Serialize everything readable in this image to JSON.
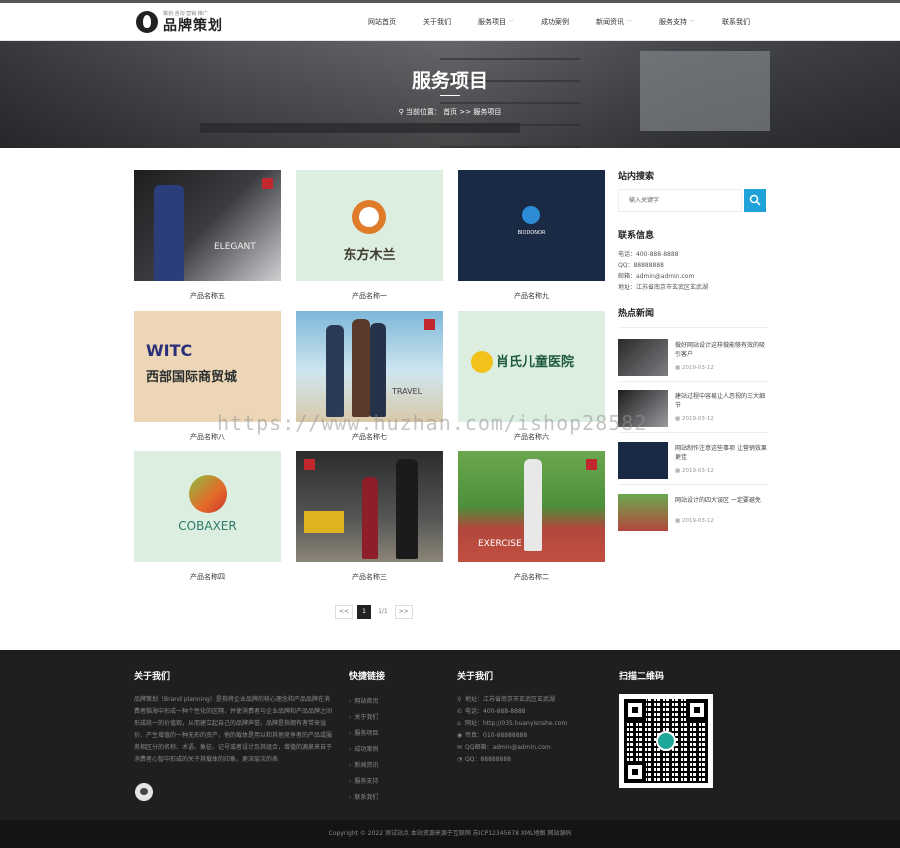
{
  "header": {
    "logo_slogan": "策划·咨询·营销·推广",
    "logo_name": "品牌策划",
    "nav": [
      {
        "label": "网站首页",
        "dropdown": false
      },
      {
        "label": "关于我们",
        "dropdown": false
      },
      {
        "label": "服务项目",
        "dropdown": true
      },
      {
        "label": "成功案例",
        "dropdown": false
      },
      {
        "label": "新闻资讯",
        "dropdown": true
      },
      {
        "label": "服务支持",
        "dropdown": true
      },
      {
        "label": "联系我们",
        "dropdown": false
      }
    ]
  },
  "banner": {
    "title": "服务项目",
    "crumb_prefix": "当前位置：",
    "crumb_home": "首页",
    "crumb_sep": ">>",
    "crumb_current": "服务项目"
  },
  "products": [
    {
      "name": "产品名称五",
      "thumb_text": "ELEGANT"
    },
    {
      "name": "产品名称一",
      "thumb_text": "东方木兰"
    },
    {
      "name": "产品名称九",
      "thumb_text": "BIODONOR"
    },
    {
      "name": "产品名称八",
      "thumb_text": "西部国际商贸城"
    },
    {
      "name": "产品名称七",
      "thumb_text": "TRAVEL"
    },
    {
      "name": "产品名称六",
      "thumb_text": "肖氏儿童医院"
    },
    {
      "name": "产品名称四",
      "thumb_text": "COBAXER"
    },
    {
      "name": "产品名称三",
      "thumb_text": ""
    },
    {
      "name": "产品名称二",
      "thumb_text": "EXERCISE"
    }
  ],
  "sidebar": {
    "search_title": "站内搜索",
    "search_placeholder": "输入关键字",
    "contact_title": "联系信息",
    "contact_lines": [
      "电话：400-888-8888",
      "QQ：88888888",
      "邮箱：admin@admin.com",
      "地址：江苏省南京市玄武区玄武湖"
    ],
    "news_title": "热点新闻",
    "news": [
      {
        "title": "做好网站设计这样做能够有效的吸引客户",
        "date": "2019-03-12"
      },
      {
        "title": "建站过程中容易让人忽视的三大细节",
        "date": "2019-03-12"
      },
      {
        "title": "网站制作注意这些事项 让营销效果更佳",
        "date": "2019-03-12"
      },
      {
        "title": "网站设计的四大误区 一定要避免",
        "date": "2019-03-12"
      }
    ]
  },
  "pagination": {
    "prev": "<<",
    "current": "1",
    "info": "1/1",
    "next": ">>"
  },
  "footer": {
    "about_title": "关于我们",
    "about_text": "品牌策划（Brand planning）是指将企业品牌的核心理念和产品品牌在消费者脑海中形成一种个性化的区隔，并使消费者与企业品牌和产品品牌之间形成统一的价值观，从而建立起自己的品牌声誉。品牌是指拥有者带来溢价、产生增值的一种无形的资产，他的载体是用以和其他竞争者的产品或服务相区分的名称、术语、象征、记号或者设计及其组合，增值的源泉来自于消费者心智中形成的关于其载体的印象。更深层次的表",
    "links_title": "快捷链接",
    "links": [
      "网站首页",
      "关于我们",
      "服务项目",
      "成功案例",
      "新闻资讯",
      "服务支持",
      "联系我们"
    ],
    "contact_title": "关于我们",
    "contact": [
      {
        "icon": "location-icon",
        "text": "地址：江苏省南京市玄武区玄武湖"
      },
      {
        "icon": "phone-icon",
        "text": "电话：400-888-8888"
      },
      {
        "icon": "home-icon",
        "text": "网址：http://035.huanyisnshe.com"
      },
      {
        "icon": "weibo-icon",
        "text": "传真：010-88888888"
      },
      {
        "icon": "mail-icon",
        "text": "QQ邮箱：admin@admin.com"
      },
      {
        "icon": "qq-icon",
        "text": "QQ：88888888"
      }
    ],
    "qr_title": "扫描二维码",
    "copyright": "Copyright © 2022 测试站点 本站资源来源于互联网   苏ICP12345678   XML地图  网站源码"
  },
  "watermark": "https://www.huzhan.com/ishop28582"
}
